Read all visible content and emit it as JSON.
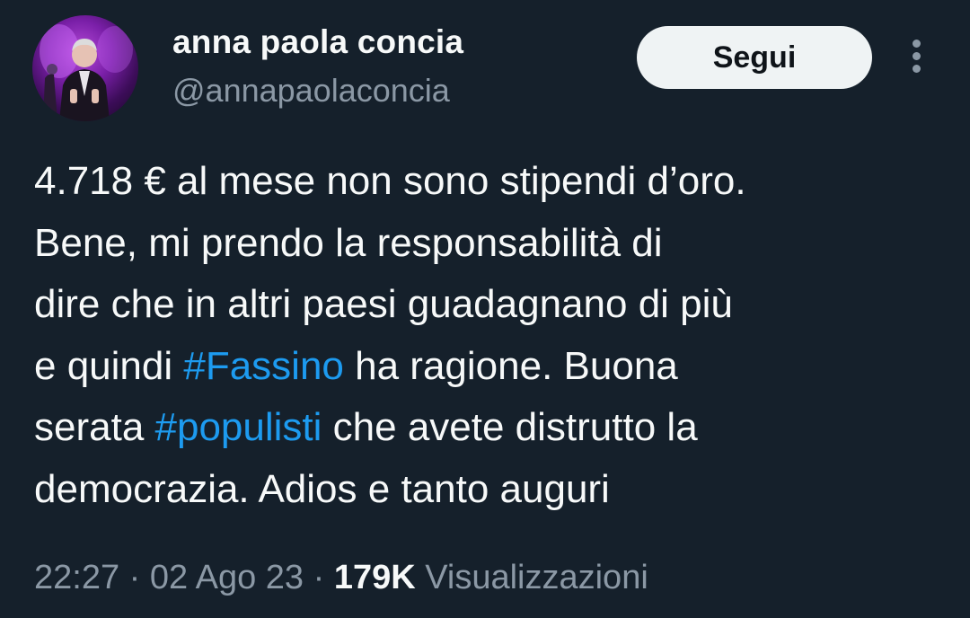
{
  "author": {
    "display_name": "anna paola concia",
    "handle": "@annapaolaconcia"
  },
  "follow_button": {
    "label": "Segui"
  },
  "more_icon": "more-vertical-icon",
  "tweet": {
    "line1": "4.718 € al mese non sono stipendi d’oro.",
    "line2": "Bene, mi prendo la responsabilità di",
    "line3": "dire che in altri paesi guadagnano di più",
    "line4_pre": "e quindi ",
    "hashtag1": "#Fassino",
    "line4_post": " ha ragione. Buona",
    "line5_pre": "serata ",
    "hashtag2": "#populisti",
    "line5_post": " che avete distrutto la",
    "line6": "democrazia. Adios e tanto auguri"
  },
  "meta": {
    "time": "22:27",
    "sep1": " · ",
    "date": "02 Ago 23",
    "sep2": " · ",
    "views_count": "179K",
    "views_label": " Visualizzazioni"
  },
  "colors": {
    "background": "#15202b",
    "text": "#f7f9f9",
    "secondary": "#8b98a5",
    "hashtag": "#1d9bf0",
    "button_bg": "#eff3f4"
  }
}
